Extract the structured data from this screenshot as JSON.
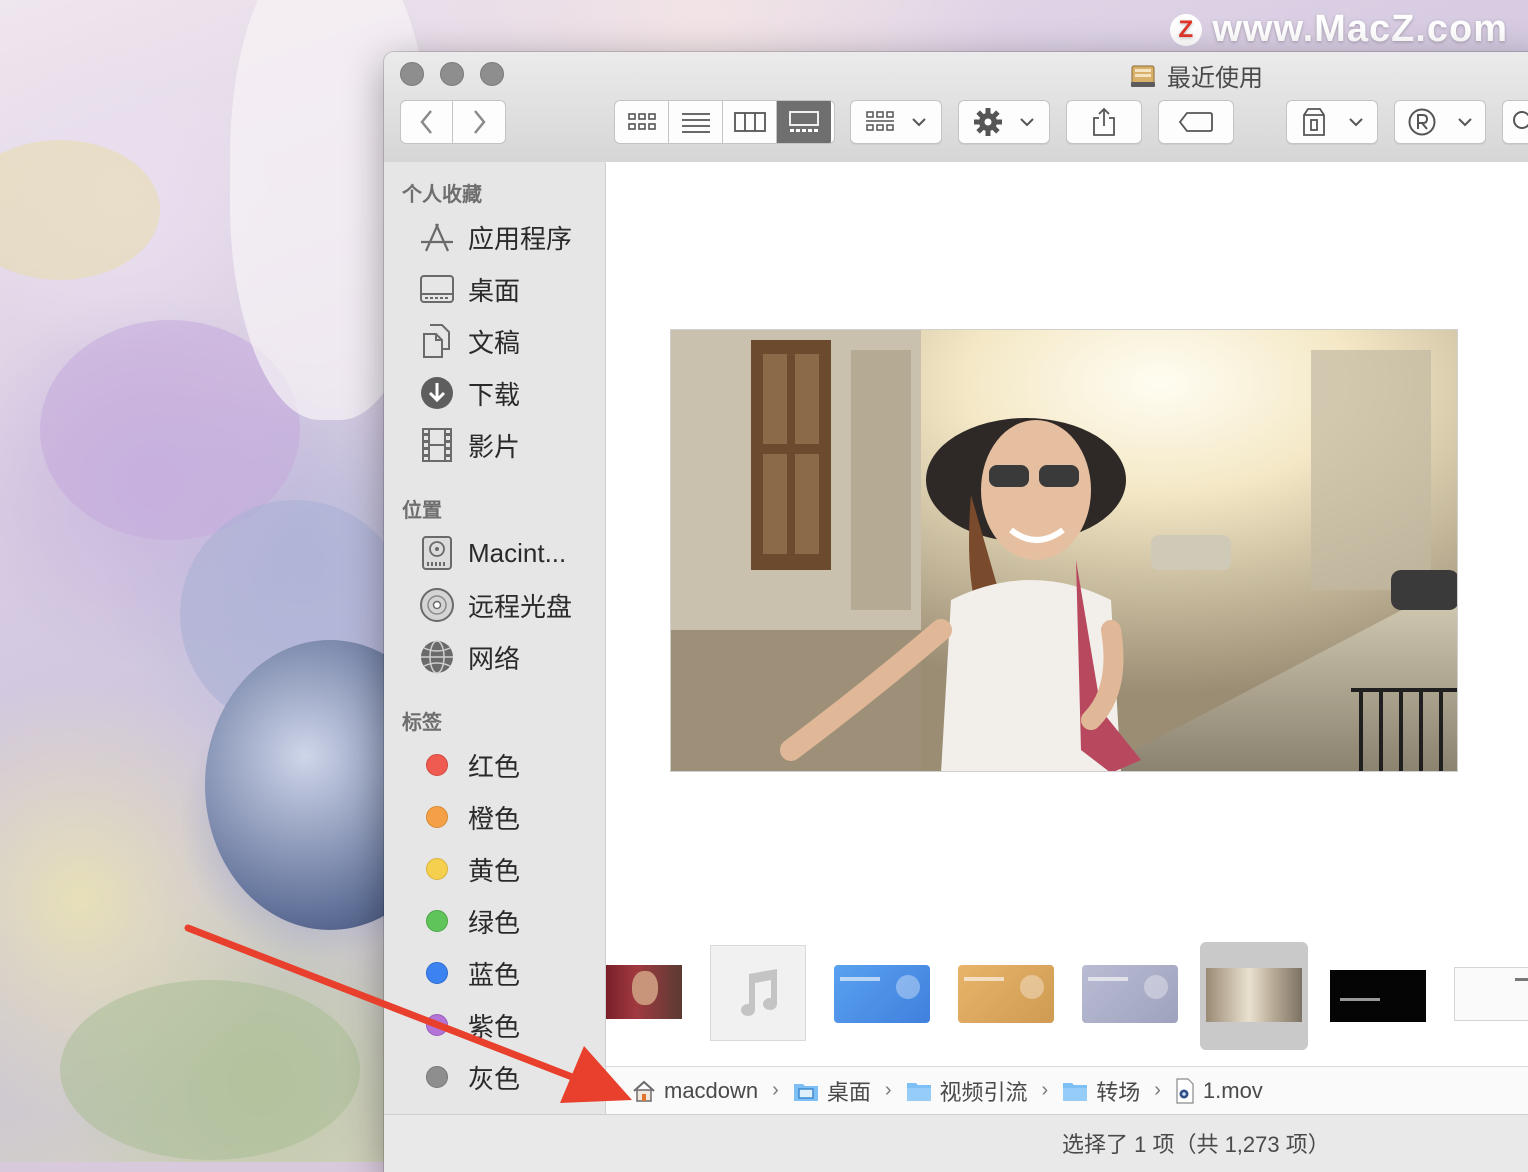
{
  "watermark": {
    "logo_letter": "Z",
    "text": "www.MacZ.com"
  },
  "window": {
    "title": "最近使用",
    "title_icon": "recents-drawer-icon"
  },
  "toolbar": {
    "back_icon": "chevron-left-icon",
    "forward_icon": "chevron-right-icon",
    "view_modes": [
      "icon-view",
      "list-view",
      "column-view",
      "gallery-view"
    ],
    "active_view": "gallery-view",
    "group_icon": "group-by-icon",
    "action_icon": "gear-icon",
    "share_icon": "share-icon",
    "tag_icon": "tag-icon",
    "extra_icons": [
      "archive-icon",
      "registered-icon",
      "search-icon"
    ]
  },
  "sidebar": {
    "favorites_header": "个人收藏",
    "favorites": [
      {
        "label": "应用程序",
        "icon": "applications-icon"
      },
      {
        "label": "桌面",
        "icon": "desktop-icon"
      },
      {
        "label": "文稿",
        "icon": "documents-icon"
      },
      {
        "label": "下载",
        "icon": "downloads-icon"
      },
      {
        "label": "影片",
        "icon": "movies-icon"
      }
    ],
    "locations_header": "位置",
    "locations": [
      {
        "label": "Macint...",
        "icon": "hard-drive-icon"
      },
      {
        "label": "远程光盘",
        "icon": "remote-disc-icon"
      },
      {
        "label": "网络",
        "icon": "network-icon"
      }
    ],
    "tags_header": "标签",
    "tags": [
      {
        "label": "红色",
        "color": "#ef5b51"
      },
      {
        "label": "橙色",
        "color": "#f3a046"
      },
      {
        "label": "黄色",
        "color": "#f5d04f"
      },
      {
        "label": "绿色",
        "color": "#5fc45a"
      },
      {
        "label": "蓝色",
        "color": "#3c82f0"
      },
      {
        "label": "紫色",
        "color": "#b473d6"
      },
      {
        "label": "灰色",
        "color": "#8e8e8e"
      }
    ]
  },
  "gallery": {
    "thumbnails": [
      {
        "name": "portrait-photo"
      },
      {
        "name": "audio-file"
      },
      {
        "name": "blue-vip-card"
      },
      {
        "name": "gold-vip-card"
      },
      {
        "name": "silver-vip-card"
      },
      {
        "name": "street-video",
        "selected": true
      },
      {
        "name": "black-title-video"
      },
      {
        "name": "white-document"
      }
    ]
  },
  "pathbar": {
    "items": [
      {
        "label": "macdown",
        "icon": "home-icon"
      },
      {
        "label": "桌面",
        "icon": "desktop-folder-icon"
      },
      {
        "label": "视频引流",
        "icon": "folder-icon"
      },
      {
        "label": "转场",
        "icon": "folder-icon"
      },
      {
        "label": "1.mov",
        "icon": "movie-file-icon"
      }
    ]
  },
  "status": {
    "text": "选择了 1 项（共 1,273 项）"
  },
  "annotation": {
    "arrow_color": "#e8402c"
  }
}
